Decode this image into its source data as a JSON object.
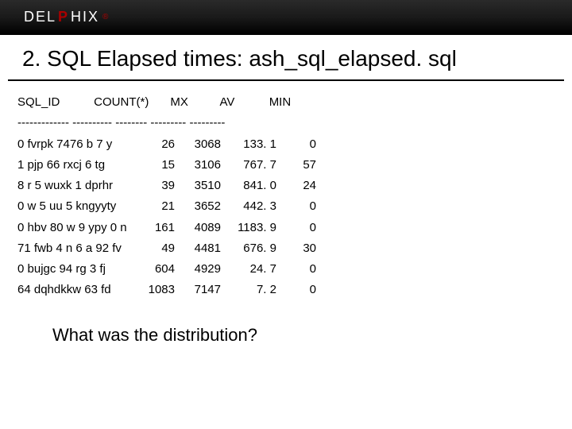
{
  "brand": {
    "prefix": "DEL",
    "accent": "P",
    "suffix": "HIX"
  },
  "title": "2. SQL Elapsed times: ash_sql_elapsed. sql",
  "table": {
    "headers": [
      "SQL_ID",
      "COUNT(*)",
      "MX",
      "AV",
      "MIN"
    ],
    "separator": "------------- ---------- -------- --------- ---------",
    "rows": [
      {
        "sql_id": "0 fvrpk 7476 b 7 y",
        "count": "26",
        "mx": "3068",
        "av": "133. 1",
        "min": "0"
      },
      {
        "sql_id": "1 pjp 66 rxcj 6 tg",
        "count": "15",
        "mx": "3106",
        "av": "767. 7",
        "min": "57"
      },
      {
        "sql_id": "8 r 5 wuxk 1 dprhr",
        "count": "39",
        "mx": "3510",
        "av": "841. 0",
        "min": "24"
      },
      {
        "sql_id": "0 w 5 uu 5 kngyyty",
        "count": "21",
        "mx": "3652",
        "av": "442. 3",
        "min": "0"
      },
      {
        "sql_id": "0 hbv 80 w 9 ypy 0 n",
        "count": "161",
        "mx": "4089",
        "av": "1183. 9",
        "min": "0"
      },
      {
        "sql_id": "71 fwb 4 n 6 a 92 fv",
        "count": "49",
        "mx": "4481",
        "av": "676. 9",
        "min": "30"
      },
      {
        "sql_id": "0 bujgc 94 rg 3 fj",
        "count": "604",
        "mx": "4929",
        "av": "24. 7",
        "min": "0"
      },
      {
        "sql_id": "64 dqhdkkw 63 fd",
        "count": "1083",
        "mx": "7147",
        "av": "7. 2",
        "min": "0"
      }
    ]
  },
  "question": "What was the distribution?"
}
